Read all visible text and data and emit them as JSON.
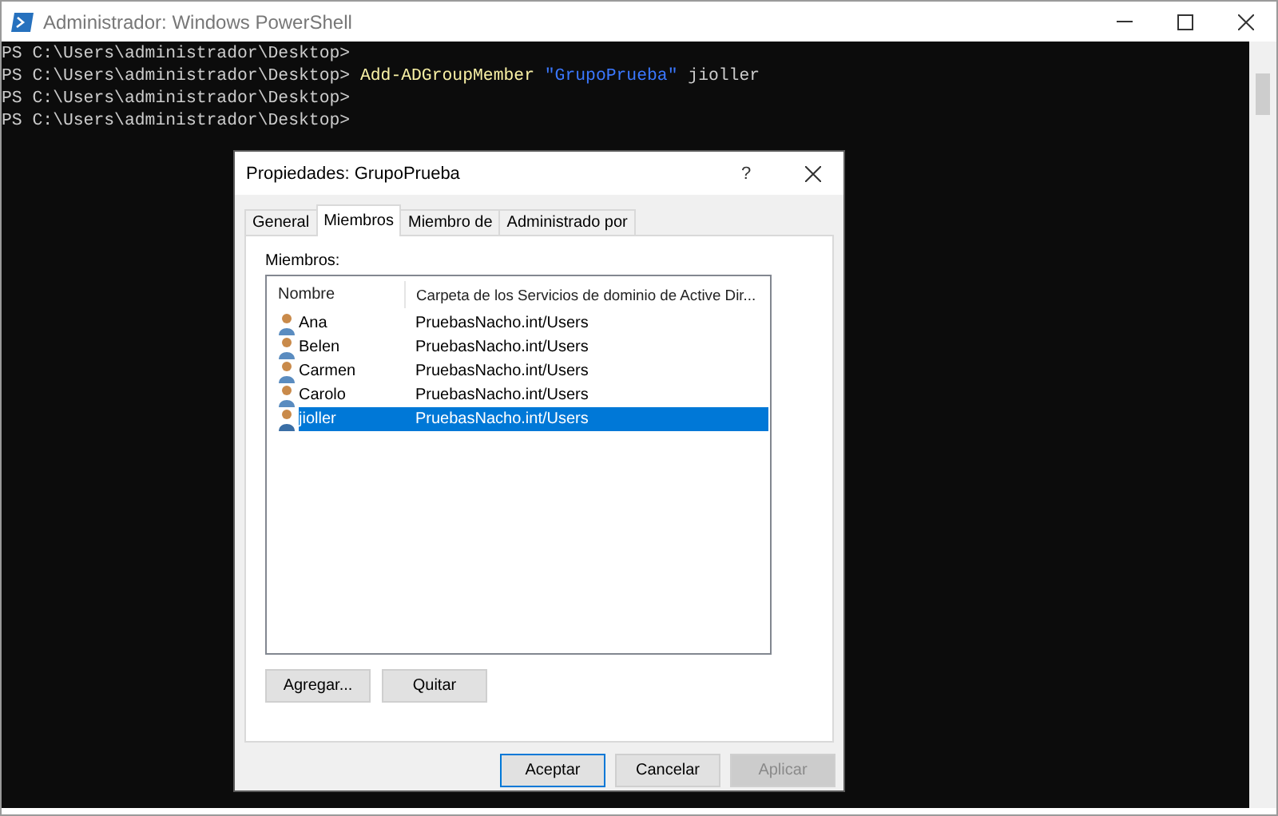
{
  "window": {
    "title": "Administrador: Windows PowerShell"
  },
  "console": {
    "lines": [
      [
        {
          "kind": "prompt",
          "text": "PS C:\\Users\\administrador\\Desktop>"
        }
      ],
      [
        {
          "kind": "prompt",
          "text": "PS C:\\Users\\administrador\\Desktop>"
        },
        {
          "kind": "command",
          "text": "Add-ADGroupMember"
        },
        {
          "kind": "string",
          "text": "\"GrupoPrueba\""
        },
        {
          "kind": "argument",
          "text": "jioller"
        }
      ],
      [
        {
          "kind": "prompt",
          "text": "PS C:\\Users\\administrador\\Desktop>"
        }
      ],
      [
        {
          "kind": "prompt",
          "text": "PS C:\\Users\\administrador\\Desktop>"
        }
      ]
    ]
  },
  "dialog": {
    "title": "Propiedades: GrupoPrueba",
    "help": "?",
    "tabs": [
      {
        "label": "General",
        "selected": false
      },
      {
        "label": "Miembros",
        "selected": true
      },
      {
        "label": "Miembro de",
        "selected": false
      },
      {
        "label": "Administrado por",
        "selected": false
      }
    ],
    "members_label": "Miembros:",
    "columns": [
      "Nombre",
      "Carpeta de los Servicios de dominio de Active Dir..."
    ],
    "rows": [
      {
        "name": "Ana",
        "folder": "PruebasNacho.int/Users",
        "selected": false
      },
      {
        "name": "Belen",
        "folder": "PruebasNacho.int/Users",
        "selected": false
      },
      {
        "name": "Carmen",
        "folder": "PruebasNacho.int/Users",
        "selected": false
      },
      {
        "name": "Carolo",
        "folder": "PruebasNacho.int/Users",
        "selected": false
      },
      {
        "name": "jioller",
        "folder": "PruebasNacho.int/Users",
        "selected": true
      }
    ],
    "list_buttons": [
      "Agregar...",
      "Quitar"
    ],
    "footer_buttons": [
      {
        "label": "Aceptar",
        "default": true,
        "disabled": false
      },
      {
        "label": "Cancelar",
        "default": false,
        "disabled": false
      },
      {
        "label": "Aplicar",
        "default": false,
        "disabled": true
      }
    ]
  }
}
